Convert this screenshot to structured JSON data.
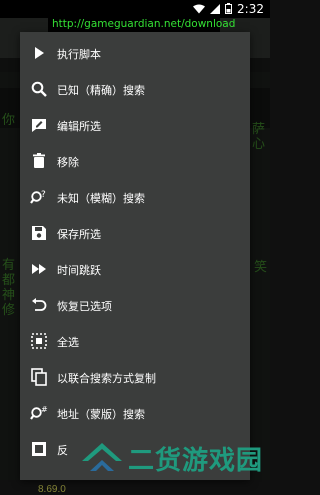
{
  "status_bar": {
    "time": "2:32",
    "icons": [
      "wifi-icon",
      "signal-icon",
      "battery-icon"
    ]
  },
  "url": "http://gameguardian.net/download",
  "menu": {
    "items": [
      {
        "label": "执行脚本",
        "icon": "play-icon"
      },
      {
        "label": "已知（精确）搜索",
        "icon": "search-icon"
      },
      {
        "label": "编辑所选",
        "icon": "edit-icon"
      },
      {
        "label": "移除",
        "icon": "trash-icon"
      },
      {
        "label": "未知（模糊）搜索",
        "icon": "fuzzy-search-icon"
      },
      {
        "label": "保存所选",
        "icon": "save-icon"
      },
      {
        "label": "时间跳跃",
        "icon": "fast-forward-icon"
      },
      {
        "label": "恢复已选项",
        "icon": "restore-icon"
      },
      {
        "label": "全选",
        "icon": "select-all-icon"
      },
      {
        "label": "以联合搜索方式复制",
        "icon": "copy-icon"
      },
      {
        "label": "地址（蒙版）搜索",
        "icon": "address-search-icon"
      },
      {
        "label": "反",
        "icon": "invert-icon"
      }
    ]
  },
  "background": {
    "left_text": "你",
    "right_text": "萨心",
    "left_text_2": "有\n都\n神\n修",
    "right_text_2": "笑",
    "price": "8.69.0"
  },
  "watermark": {
    "text": "二货游戏园",
    "color": "#1f9a7e"
  }
}
